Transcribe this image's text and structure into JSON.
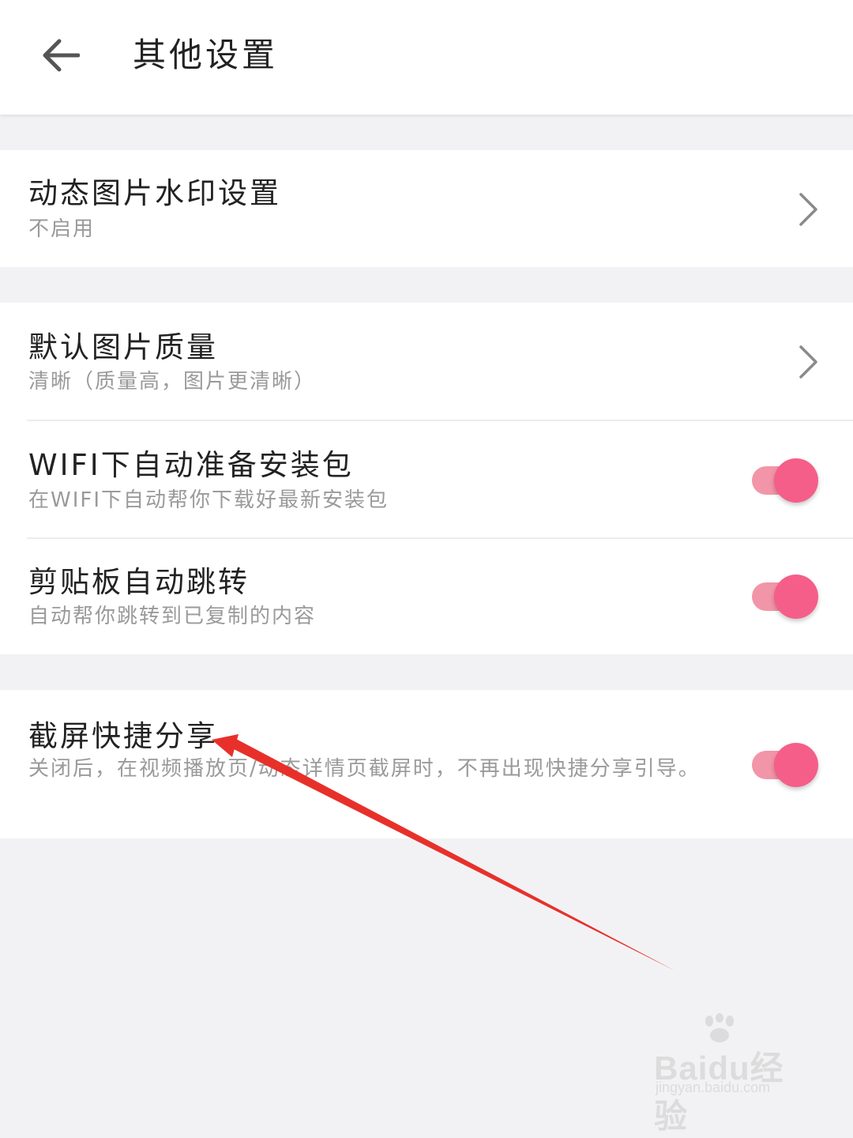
{
  "header": {
    "title": "其他设置"
  },
  "settings": {
    "watermark": {
      "title": "动态图片水印设置",
      "subtitle": "不启用"
    },
    "quality": {
      "title": "默认图片质量",
      "subtitle": "清晰（质量高，图片更清晰）"
    },
    "wifi": {
      "title": "WIFI下自动准备安装包",
      "subtitle": "在WIFI下自动帮你下载好最新安装包",
      "enabled": true
    },
    "clipboard": {
      "title": "剪贴板自动跳转",
      "subtitle": "自动帮你跳转到已复制的内容",
      "enabled": true
    },
    "screenshot": {
      "title": "截屏快捷分享",
      "subtitle": "关闭后，在视频播放页/动态详情页截屏时，不再出现快捷分享引导。",
      "enabled": true
    }
  },
  "colors": {
    "toggle_track": "#f295a8",
    "toggle_knob": "#f55e88",
    "annotation_arrow": "#e8302a"
  },
  "watermark_brand": {
    "text": "Baidu经验",
    "url_text": "jingyan.baidu.com"
  }
}
